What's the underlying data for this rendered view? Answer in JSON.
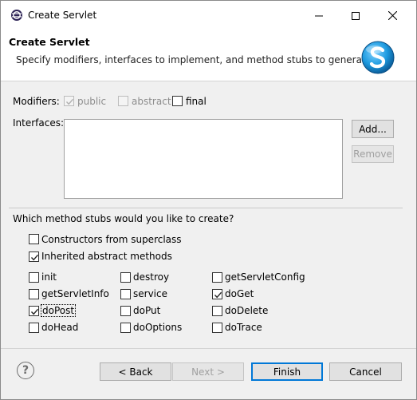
{
  "window": {
    "title": "Create Servlet"
  },
  "banner": {
    "title": "Create Servlet",
    "description": "Specify modifiers, interfaces to implement, and method stubs to generate."
  },
  "modifiers": {
    "label": "Modifiers:",
    "public": {
      "label": "public",
      "checked": true,
      "enabled": false
    },
    "abstract": {
      "label": "abstract",
      "checked": false,
      "enabled": false
    },
    "final": {
      "label": "final",
      "checked": false,
      "enabled": true
    }
  },
  "interfaces": {
    "label": "Interfaces:",
    "items": [],
    "add_label": "Add...",
    "remove_label": "Remove"
  },
  "stubs": {
    "question": "Which method stubs would you like to create?",
    "constructors": {
      "label": "Constructors from superclass",
      "checked": false
    },
    "inherited": {
      "label": "Inherited abstract methods",
      "checked": true
    },
    "methods": [
      {
        "label": "init",
        "checked": false
      },
      {
        "label": "destroy",
        "checked": false
      },
      {
        "label": "getServletConfig",
        "checked": false
      },
      {
        "label": "getServletInfo",
        "checked": false
      },
      {
        "label": "service",
        "checked": false
      },
      {
        "label": "doGet",
        "checked": true
      },
      {
        "label": "doPost",
        "checked": true
      },
      {
        "label": "doPut",
        "checked": false
      },
      {
        "label": "doDelete",
        "checked": false
      },
      {
        "label": "doHead",
        "checked": false
      },
      {
        "label": "doOptions",
        "checked": false
      },
      {
        "label": "doTrace",
        "checked": false
      }
    ]
  },
  "footer": {
    "help_symbol": "?",
    "back_label": "< Back",
    "next_label": "Next >",
    "finish_label": "Finish",
    "cancel_label": "Cancel"
  },
  "colors": {
    "accent": "#0078d7",
    "logo": "#1e9be0"
  }
}
